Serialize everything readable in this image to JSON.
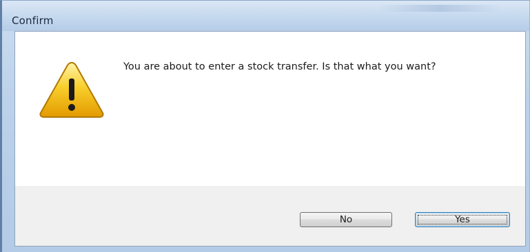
{
  "window": {
    "title": "Confirm"
  },
  "dialog": {
    "icon": "warning-icon",
    "message": "You are about to enter a stock transfer. Is that what you want?"
  },
  "buttons": {
    "no_label": "No",
    "yes_label": "Yes",
    "default": "Yes"
  },
  "colors": {
    "titlebar": "#c4d8ee",
    "warning_fill": "#f2b705",
    "warning_outline": "#b8860b"
  }
}
